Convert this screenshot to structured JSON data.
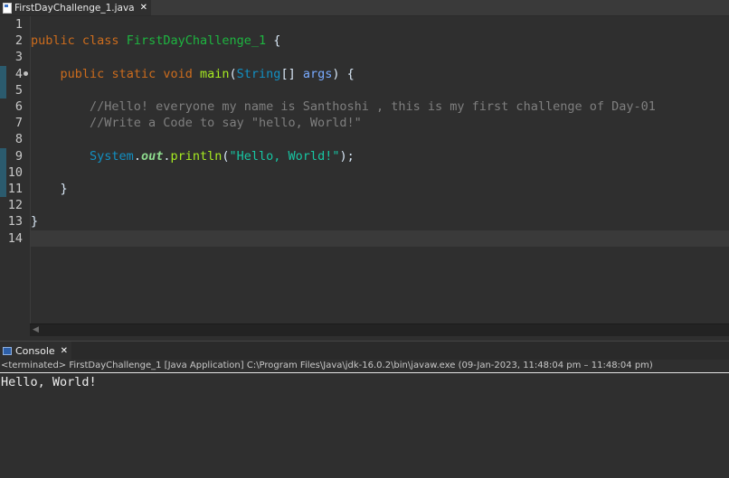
{
  "editor": {
    "tab": {
      "label": "FirstDayChallenge_1.java",
      "close": "✕"
    },
    "line_numbers": [
      "1",
      "2",
      "3",
      "4",
      "5",
      "6",
      "7",
      "8",
      "9",
      "10",
      "11",
      "12",
      "13",
      "14"
    ],
    "code": {
      "l2": {
        "kw1": "public",
        "kw2": "class",
        "classname": "FirstDayChallenge_1",
        "brace": " {"
      },
      "l4": {
        "kw1": "public",
        "kw2": "static",
        "kw3": "void",
        "method": "main",
        "open": "(",
        "type": "String",
        "arr": "[] ",
        "param": "args",
        "close": ") {"
      },
      "l6": {
        "comment": "//Hello! everyone my name is Santhoshi , this is my first challenge of Day-01"
      },
      "l7": {
        "comment": "//Write a Code to say \"hello, World!\""
      },
      "l9": {
        "class": "System",
        "dot1": ".",
        "field": "out",
        "dot2": ".",
        "method": "println",
        "open": "(",
        "string": "\"Hello, World!\"",
        "close": ");"
      },
      "l11": {
        "brace": "}"
      },
      "l13": {
        "brace": "}"
      }
    }
  },
  "console": {
    "tab": {
      "label": "Console",
      "close": "✕"
    },
    "status": "<terminated> FirstDayChallenge_1 [Java Application] C:\\Program Files\\Java\\jdk-16.0.2\\bin\\javaw.exe  (09-Jan-2023, 11:48:04 pm – 11:48:04 pm)",
    "output": "Hello, World!"
  },
  "colors": {
    "keyword": "#cc6c1d",
    "class_name": "#1eb540",
    "method": "#a7ec21",
    "param": "#79abff",
    "comment": "#7f7f7f",
    "string": "#17c6a3"
  }
}
